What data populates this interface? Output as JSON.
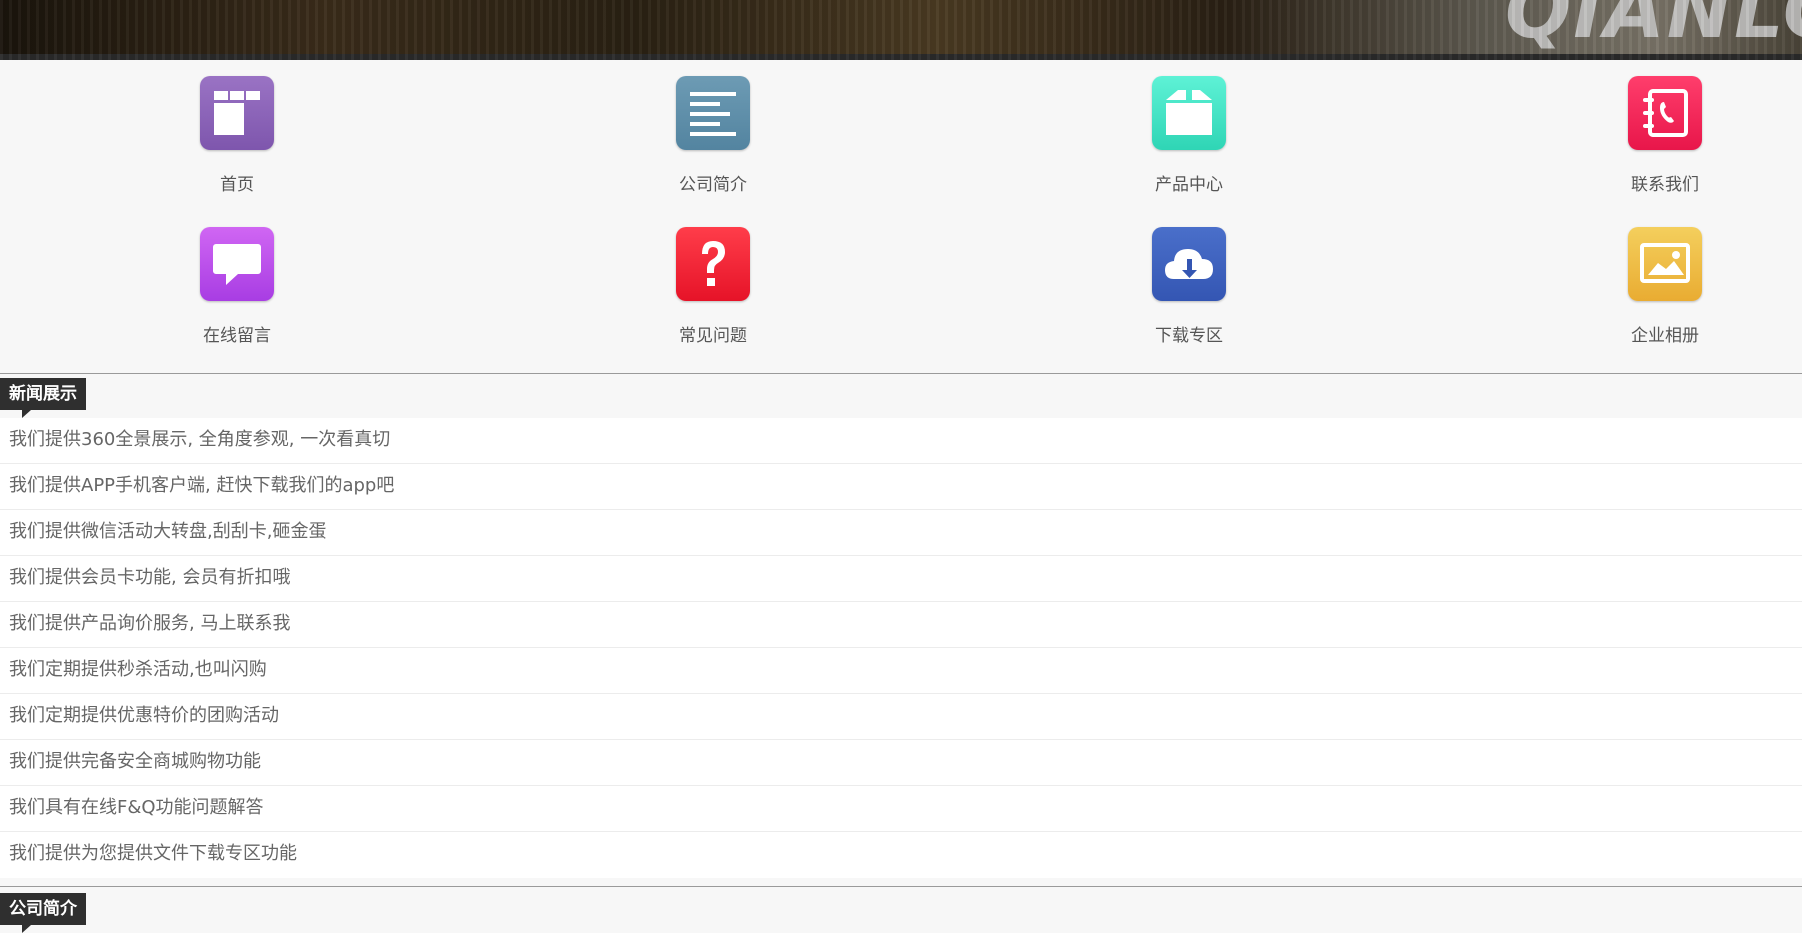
{
  "banner": {
    "logo_text": "QIANLON"
  },
  "nav": [
    {
      "label": "首页",
      "icon": "home-layout-icon",
      "color": "#8a62b8"
    },
    {
      "label": "公司简介",
      "icon": "document-lines-icon",
      "color": "#5d8eaa"
    },
    {
      "label": "产品中心",
      "icon": "box-icon",
      "color": "#3fe0c2"
    },
    {
      "label": "联系我们",
      "icon": "address-book-phone-icon",
      "color": "#f22657"
    },
    {
      "label": "在线留言",
      "icon": "speech-bubble-icon",
      "color": "#bb4dea"
    },
    {
      "label": "常见问题",
      "icon": "question-mark-icon",
      "color": "#f22433"
    },
    {
      "label": "下载专区",
      "icon": "cloud-download-icon",
      "color": "#3f61bf"
    },
    {
      "label": "企业相册",
      "icon": "photo-album-icon",
      "color": "#eebd47"
    }
  ],
  "news": {
    "title": "新闻展示",
    "items": [
      "我们提供360全景展示, 全角度参观, 一次看真切",
      "我们提供APP手机客户端, 赶快下载我们的app吧",
      "我们提供微信活动大转盘,刮刮卡,砸金蛋",
      "我们提供会员卡功能, 会员有折扣哦",
      "我们提供产品询价服务, 马上联系我",
      "我们定期提供秒杀活动,也叫闪购",
      "我们定期提供优惠特价的团购活动",
      "我们提供完备安全商城购物功能",
      "我们具有在线F&Q功能问题解答",
      "我们提供为您提供文件下载专区功能"
    ]
  },
  "about": {
    "title": "公司简介"
  }
}
